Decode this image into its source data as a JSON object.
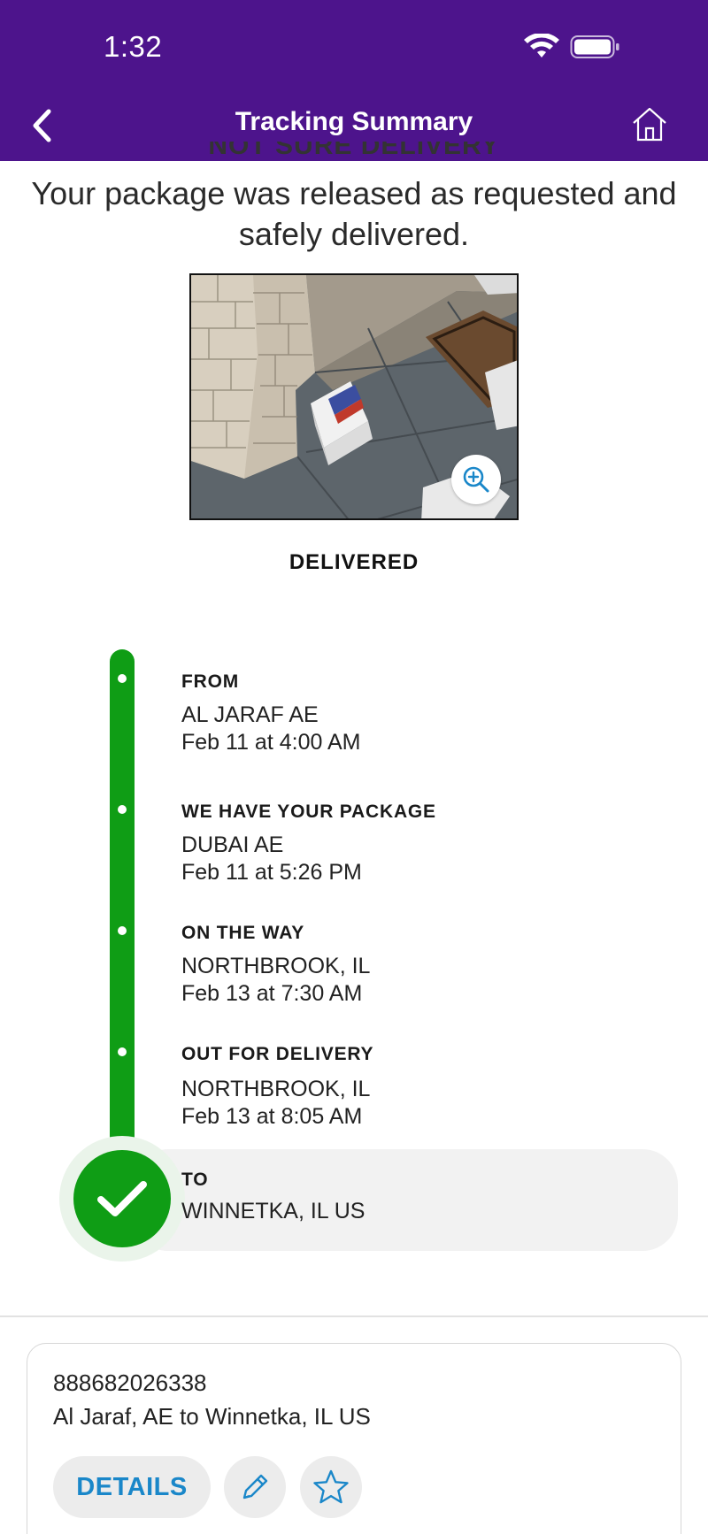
{
  "status_bar": {
    "time": "1:32"
  },
  "nav": {
    "title": "Tracking Summary"
  },
  "summary": {
    "heading_clipped": "NOT SURE DELIVERY",
    "message": "Your package was released as requested and safely delivered.",
    "status": "DELIVERED"
  },
  "timeline": [
    {
      "title": "FROM",
      "location": "AL JARAF AE",
      "time": "Feb 11 at 4:00 AM"
    },
    {
      "title": "WE HAVE YOUR PACKAGE",
      "location": "DUBAI AE",
      "time": "Feb 11 at 5:26 PM"
    },
    {
      "title": "ON THE WAY",
      "location": "NORTHBROOK, IL",
      "time": "Feb 13 at 7:30 AM"
    },
    {
      "title": "OUT FOR DELIVERY",
      "location": "NORTHBROOK, IL",
      "time": "Feb 13 at 8:05 AM"
    },
    {
      "title": "TO",
      "location": "WINNETKA, IL  US"
    }
  ],
  "card": {
    "tracking_number": "888682026338",
    "route": "Al Jaraf, AE to Winnetka, IL US",
    "details_label": "DETAILS"
  },
  "colors": {
    "brand_purple": "#4d148c",
    "progress_green": "#0f9d15",
    "link_blue": "#1a87c9"
  },
  "icons": [
    "back-chevron-icon",
    "home-icon",
    "wifi-icon",
    "battery-icon",
    "zoom-in-icon",
    "checkmark-icon",
    "edit-pencil-icon",
    "star-icon"
  ]
}
